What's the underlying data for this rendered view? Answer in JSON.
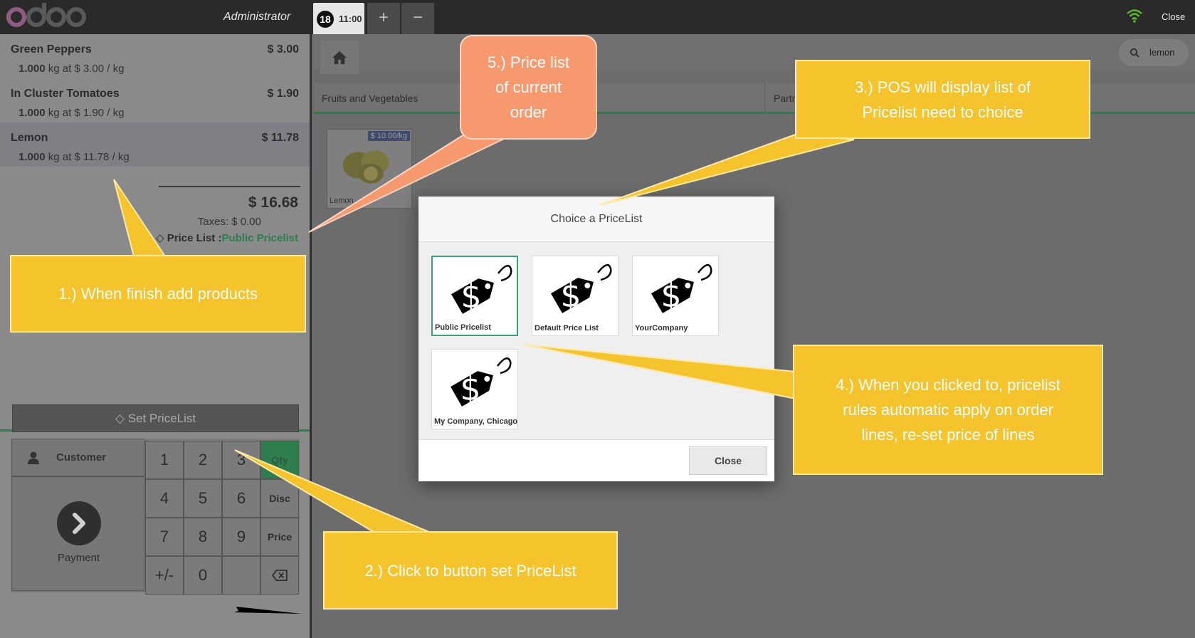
{
  "topbar": {
    "user": "Administrator",
    "order_number": "18",
    "order_time": "11:00",
    "add_label": "+",
    "remove_label": "−",
    "close_label": "Close"
  },
  "order": {
    "lines": [
      {
        "name": "Green Peppers",
        "price": "$ 3.00",
        "qty": "1.000",
        "detail": "kg at $ 3.00 / kg"
      },
      {
        "name": "In Cluster Tomatoes",
        "price": "$ 1.90",
        "qty": "1.000",
        "detail": "kg at $ 1.90 / kg"
      },
      {
        "name": "Lemon",
        "price": "$ 11.78",
        "qty": "1.000",
        "detail": "kg at $ 11.78 / kg"
      }
    ],
    "total": "$ 16.68",
    "taxes": "Taxes: $ 0.00",
    "pricelist_label": "Price List :",
    "pricelist_value": "Public Pricelist"
  },
  "controls": {
    "set_pricelist": "Set PriceList",
    "customer": "Customer",
    "payment": "Payment",
    "keys": [
      "1",
      "2",
      "3",
      "4",
      "5",
      "6",
      "7",
      "8",
      "9",
      "+/-",
      "0"
    ],
    "mode_qty": "Qty",
    "mode_disc": "Disc",
    "mode_price": "Price"
  },
  "products": {
    "search_value": "lemon",
    "categories": [
      "Fruits and Vegetables",
      "Partn"
    ],
    "items": [
      {
        "name": "Lemon",
        "price_badge": "$ 10.00/kg"
      }
    ]
  },
  "modal": {
    "title": "Choice a PriceList",
    "pricelists": [
      "Public Pricelist",
      "Default Price List",
      "YourCompany",
      "My Company, Chicago"
    ],
    "selected_pricelist": "Public Pricelist",
    "close_label": "Close"
  },
  "callouts": {
    "c1": "1.) When finish add products",
    "c2": "2.) Click to button set PriceList",
    "c3_l1": "3.) POS will display list of",
    "c3_l2": "Pricelist need to choice",
    "c4_l1": "4.) When you clicked to, pricelist",
    "c4_l2": "rules automatic apply on order",
    "c4_l3": "lines, re-set price of lines",
    "c5_l1": "5.) Price list",
    "c5_l2": "of current",
    "c5_l3": "order"
  },
  "colors": {
    "accent_green": "#2e7d4f",
    "callout_yellow": "#f5c32c",
    "callout_salmon": "#f7996e"
  }
}
